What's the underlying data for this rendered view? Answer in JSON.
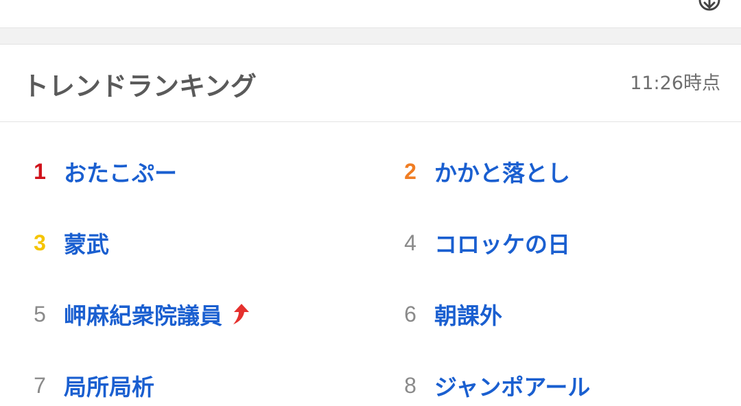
{
  "header": {
    "title": "トレンドランキング",
    "time": "11:26時点"
  },
  "colors": {
    "rank1": "#d0121b",
    "rank2": "#f07d23",
    "rank3": "#f5c400",
    "rank_default": "#8a8a8a",
    "keyword": "#1a5fd0",
    "up_arrow": "#e5312e"
  },
  "rankings": [
    {
      "rank": "1",
      "word": "おたこぷー"
    },
    {
      "rank": "2",
      "word": "かかと落とし"
    },
    {
      "rank": "3",
      "word": "蒙武"
    },
    {
      "rank": "4",
      "word": "コロッケの日"
    },
    {
      "rank": "5",
      "word": "岬麻紀衆院議員",
      "trend_icon": "up-arrow-icon"
    },
    {
      "rank": "6",
      "word": "朝課外"
    },
    {
      "rank": "7",
      "word": "局所局析"
    },
    {
      "rank": "8",
      "word": "ジャンポアール"
    }
  ]
}
